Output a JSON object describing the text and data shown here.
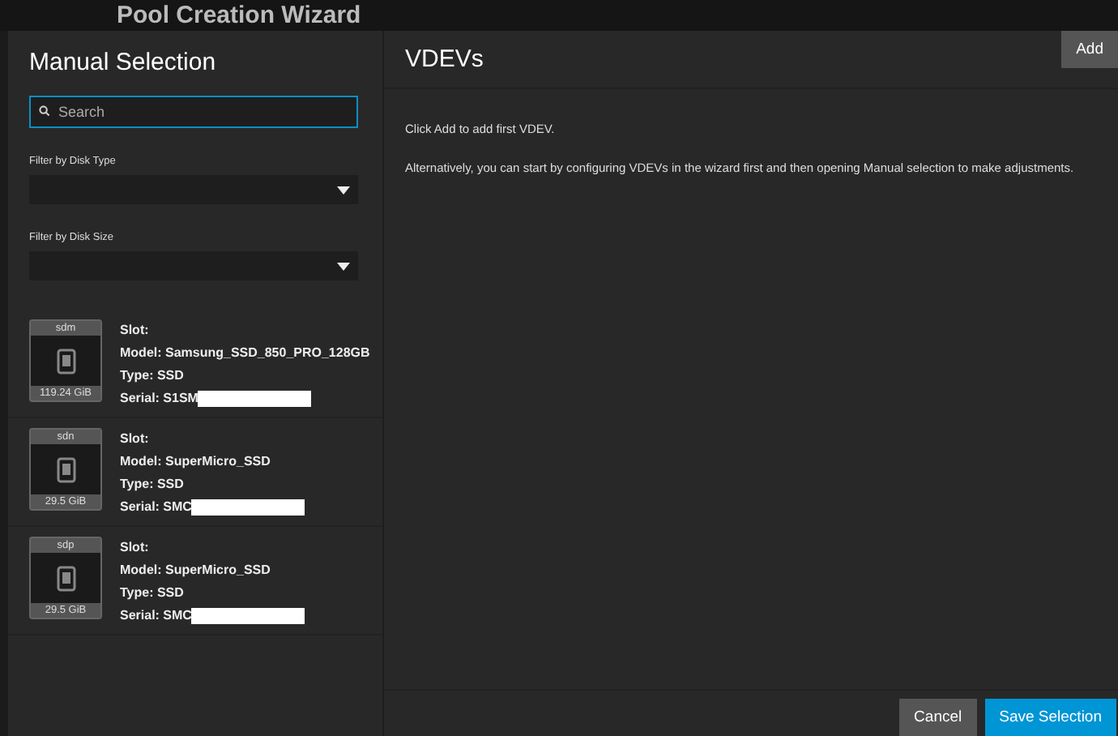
{
  "page_title": "Pool Creation Wizard",
  "left_panel": {
    "title": "Manual Selection",
    "search": {
      "placeholder": "Search"
    },
    "filters": [
      {
        "label": "Filter by Disk Type"
      },
      {
        "label": "Filter by Disk Size"
      }
    ],
    "disks": [
      {
        "name": "sdm",
        "size": "119.24 GiB",
        "slot": "Slot:",
        "model": "Model: Samsung_SSD_850_PRO_128GB",
        "type": "Type: SSD",
        "serial": "Serial: S1SM",
        "redacted": true
      },
      {
        "name": "sdn",
        "size": "29.5 GiB",
        "slot": "Slot:",
        "model": "Model: SuperMicro_SSD",
        "type": "Type: SSD",
        "serial": "Serial: SMC",
        "redacted": true
      },
      {
        "name": "sdp",
        "size": "29.5 GiB",
        "slot": "Slot:",
        "model": "Model: SuperMicro_SSD",
        "type": "Type: SSD",
        "serial": "Serial: SMC",
        "redacted": true
      }
    ]
  },
  "right_panel": {
    "title": "VDEVs",
    "add_button": "Add",
    "messages": [
      "Click Add to add first VDEV.",
      "Alternatively, you can start by configuring VDEVs in the wizard first and then opening Manual selection to make adjustments."
    ]
  },
  "footer": {
    "buttons": [
      {
        "label": "Cancel",
        "kind": "secondary"
      },
      {
        "label": "Save Selection",
        "kind": "primary"
      }
    ]
  }
}
